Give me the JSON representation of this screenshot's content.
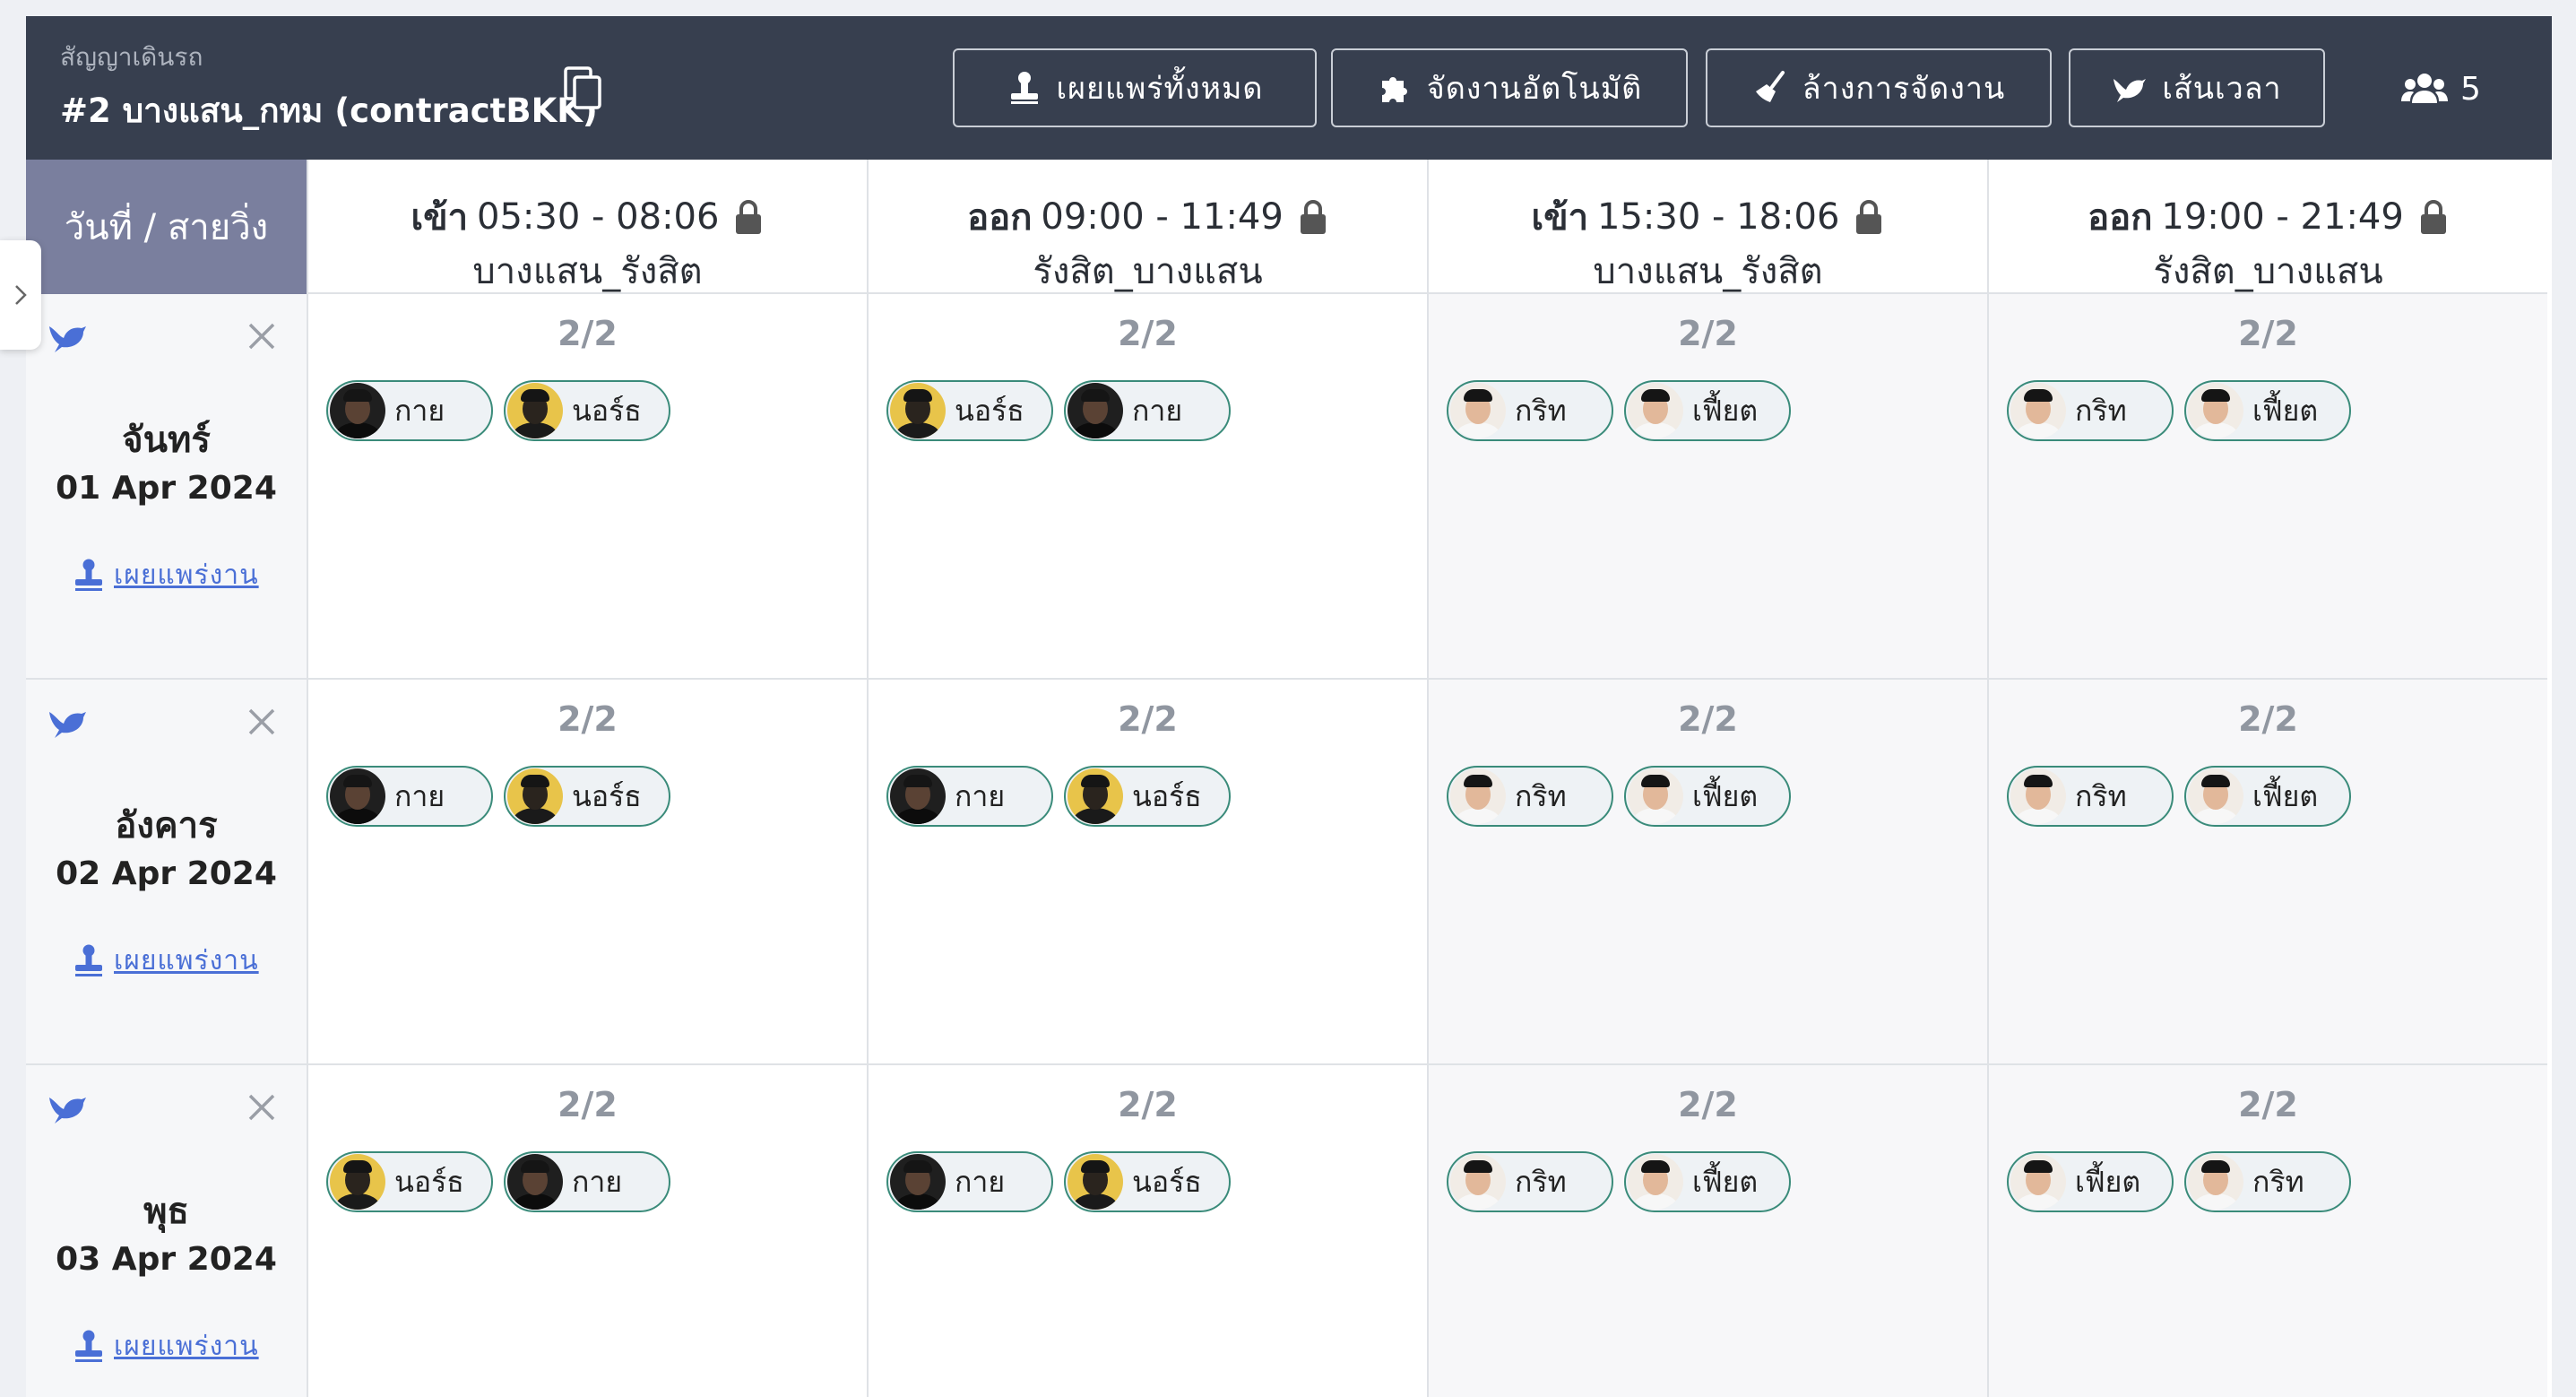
{
  "header": {
    "subtitle": "สัญญาเดินรถ",
    "title": "#2 บางแสน_กทม (contractBKK)",
    "buttons": [
      {
        "label": "เผยแพร่ทั้งหมด",
        "icon": "stamp-icon"
      },
      {
        "label": "จัดงานอัตโนมัติ",
        "icon": "puzzle-icon"
      },
      {
        "label": "ล้างการจัดงาน",
        "icon": "broom-icon"
      },
      {
        "label": "เส้นเวลา",
        "icon": "bird-icon"
      }
    ],
    "people_count": "5"
  },
  "grid": {
    "corner_label": "วันที่ / สายวิ่ง",
    "shifts": [
      {
        "dir": "เข้า",
        "time": "05:30 - 08:06",
        "route": "บางแสน_รังสิต",
        "locked": true
      },
      {
        "dir": "ออก",
        "time": "09:00 - 11:49",
        "route": "รังสิต_บางแสน",
        "locked": true
      },
      {
        "dir": "เข้า",
        "time": "15:30 - 18:06",
        "route": "บางแสน_รังสิต",
        "locked": true
      },
      {
        "dir": "ออก",
        "time": "19:00 - 21:49",
        "route": "รังสิต_บางแสน",
        "locked": true
      }
    ],
    "days": [
      {
        "name": "จันทร์",
        "date": "01 Apr 2024",
        "publish_label": "เผยแพร่งาน",
        "slots": [
          {
            "count": "2/2",
            "staff": [
              {
                "name": "กาย",
                "avatar": "dark"
              },
              {
                "name": "นอร์ธ",
                "avatar": "yellow"
              }
            ]
          },
          {
            "count": "2/2",
            "staff": [
              {
                "name": "นอร์ธ",
                "avatar": "yellow"
              },
              {
                "name": "กาย",
                "avatar": "dark"
              }
            ]
          },
          {
            "count": "2/2",
            "staff": [
              {
                "name": "กริท",
                "avatar": "pale"
              },
              {
                "name": "เฟี้ยต",
                "avatar": "pale"
              }
            ]
          },
          {
            "count": "2/2",
            "staff": [
              {
                "name": "กริท",
                "avatar": "pale"
              },
              {
                "name": "เฟี้ยต",
                "avatar": "pale"
              }
            ]
          }
        ]
      },
      {
        "name": "อังคาร",
        "date": "02 Apr 2024",
        "publish_label": "เผยแพร่งาน",
        "slots": [
          {
            "count": "2/2",
            "staff": [
              {
                "name": "กาย",
                "avatar": "dark"
              },
              {
                "name": "นอร์ธ",
                "avatar": "yellow"
              }
            ]
          },
          {
            "count": "2/2",
            "staff": [
              {
                "name": "กาย",
                "avatar": "dark"
              },
              {
                "name": "นอร์ธ",
                "avatar": "yellow"
              }
            ]
          },
          {
            "count": "2/2",
            "staff": [
              {
                "name": "กริท",
                "avatar": "pale"
              },
              {
                "name": "เฟี้ยต",
                "avatar": "pale"
              }
            ]
          },
          {
            "count": "2/2",
            "staff": [
              {
                "name": "กริท",
                "avatar": "pale"
              },
              {
                "name": "เฟี้ยต",
                "avatar": "pale"
              }
            ]
          }
        ]
      },
      {
        "name": "พุธ",
        "date": "03 Apr 2024",
        "publish_label": "เผยแพร่งาน",
        "slots": [
          {
            "count": "2/2",
            "staff": [
              {
                "name": "นอร์ธ",
                "avatar": "yellow"
              },
              {
                "name": "กาย",
                "avatar": "dark"
              }
            ]
          },
          {
            "count": "2/2",
            "staff": [
              {
                "name": "กาย",
                "avatar": "dark"
              },
              {
                "name": "นอร์ธ",
                "avatar": "yellow"
              }
            ]
          },
          {
            "count": "2/2",
            "staff": [
              {
                "name": "กริท",
                "avatar": "pale"
              },
              {
                "name": "เฟี้ยต",
                "avatar": "pale"
              }
            ]
          },
          {
            "count": "2/2",
            "staff": [
              {
                "name": "เฟี้ยต",
                "avatar": "pale"
              },
              {
                "name": "กริท",
                "avatar": "pale"
              }
            ]
          }
        ]
      }
    ]
  },
  "colors": {
    "topbar": "#373f4f",
    "corner": "#7a7f9e",
    "chip_border": "#3a8b7a",
    "link": "#4a6fd6"
  }
}
